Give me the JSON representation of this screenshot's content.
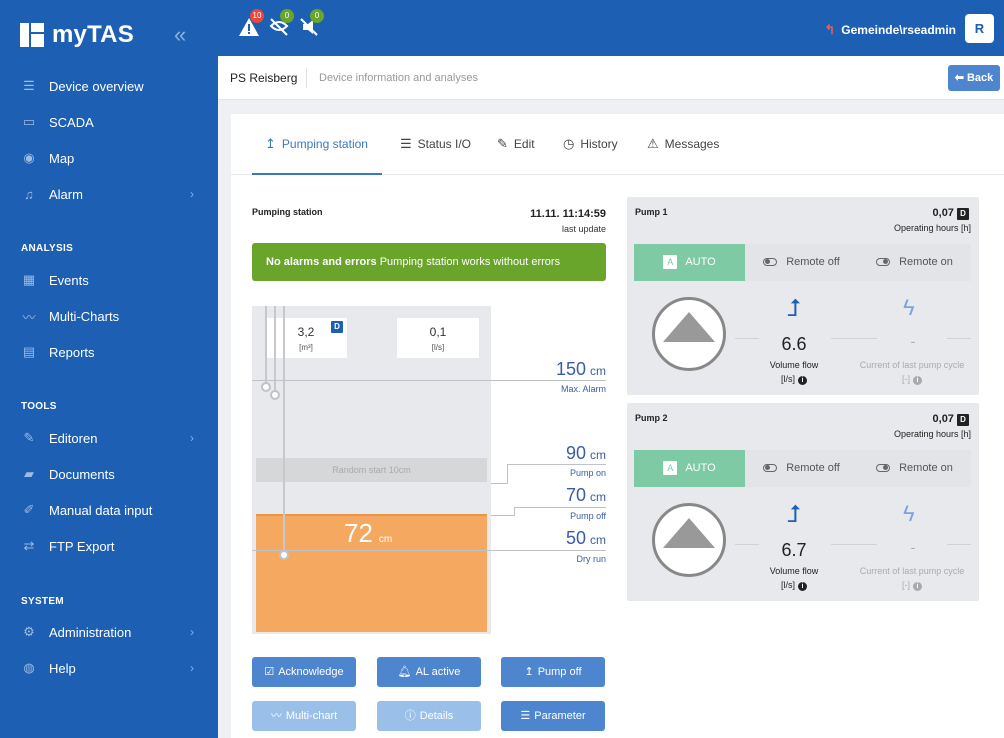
{
  "app": {
    "title": "myTAS"
  },
  "sidebar": {
    "items": [
      {
        "label": "Device overview",
        "icon": "list-icon"
      },
      {
        "label": "SCADA",
        "icon": "monitor-icon"
      },
      {
        "label": "Map",
        "icon": "map-pin-icon"
      },
      {
        "label": "Alarm",
        "icon": "bell-icon"
      }
    ],
    "analysis_label": "ANALYSIS",
    "analysis": [
      {
        "label": "Events"
      },
      {
        "label": "Multi-Charts"
      },
      {
        "label": "Reports"
      }
    ],
    "tools_label": "TOOLS",
    "tools": [
      {
        "label": "Editoren"
      },
      {
        "label": "Documents"
      },
      {
        "label": "Manual data input"
      },
      {
        "label": "FTP Export"
      }
    ],
    "system_label": "SYSTEM",
    "system": [
      {
        "label": "Administration"
      },
      {
        "label": "Help"
      }
    ]
  },
  "topbar": {
    "alarm_count": "10",
    "warn_count": "0",
    "mute_count": "0",
    "user": "Gemeinde\\rseadmin",
    "avatar": "R",
    "colors": {
      "alarm": "#e8473c",
      "ok": "#6aa52b"
    }
  },
  "subheader": {
    "title": "PS Reisberg",
    "subtitle": "Device information and analyses",
    "back_label": "Back"
  },
  "tabs": [
    {
      "label": "Pumping station"
    },
    {
      "label": "Status I/O"
    },
    {
      "label": "Edit"
    },
    {
      "label": "History"
    },
    {
      "label": "Messages"
    }
  ],
  "station": {
    "title": "Pumping station",
    "timestamp": "11.11. 11:14:59",
    "timestamp_label": "last update",
    "status_bold": "No alarms and errors",
    "status_text": "Pumping station works without errors",
    "volume": {
      "value": "3,2",
      "unit": "[m³]",
      "tag": "D"
    },
    "flow": {
      "value": "0,1",
      "unit": "[l/s]"
    },
    "random_start": "Random start 10cm",
    "level": {
      "value": "72",
      "unit": "cm",
      "fill_fraction": 0.37
    },
    "thresholds": [
      {
        "value": "150",
        "unit": "cm",
        "label": "Max. Alarm"
      },
      {
        "value": "90",
        "unit": "cm",
        "label": "Pump on"
      },
      {
        "value": "70",
        "unit": "cm",
        "label": "Pump off"
      },
      {
        "value": "50",
        "unit": "cm",
        "label": "Dry run"
      }
    ]
  },
  "buttons": {
    "acknowledge": "Acknowledge",
    "al_active": "AL active",
    "pump_off": "Pump off",
    "multi_chart": "Multi-chart",
    "details": "Details",
    "parameter": "Parameter"
  },
  "pumps": [
    {
      "name": "Pump 1",
      "hours": "0,07",
      "hours_tag": "D",
      "hours_label": "Operating hours [h]",
      "auto": "AUTO",
      "remote_off": "Remote off",
      "remote_on": "Remote on",
      "flow_value": "6.6",
      "flow_label": "Volume flow",
      "flow_unit": "[l/s]",
      "current_value": "-",
      "current_label": "Current of last pump cycle",
      "current_unit": "[-]"
    },
    {
      "name": "Pump 2",
      "hours": "0,07",
      "hours_tag": "D",
      "hours_label": "Operating hours [h]",
      "auto": "AUTO",
      "remote_off": "Remote off",
      "remote_on": "Remote on",
      "flow_value": "6.7",
      "flow_label": "Volume flow",
      "flow_unit": "[l/s]",
      "current_value": "-",
      "current_label": "Current of last pump cycle",
      "current_unit": "[-]"
    }
  ]
}
